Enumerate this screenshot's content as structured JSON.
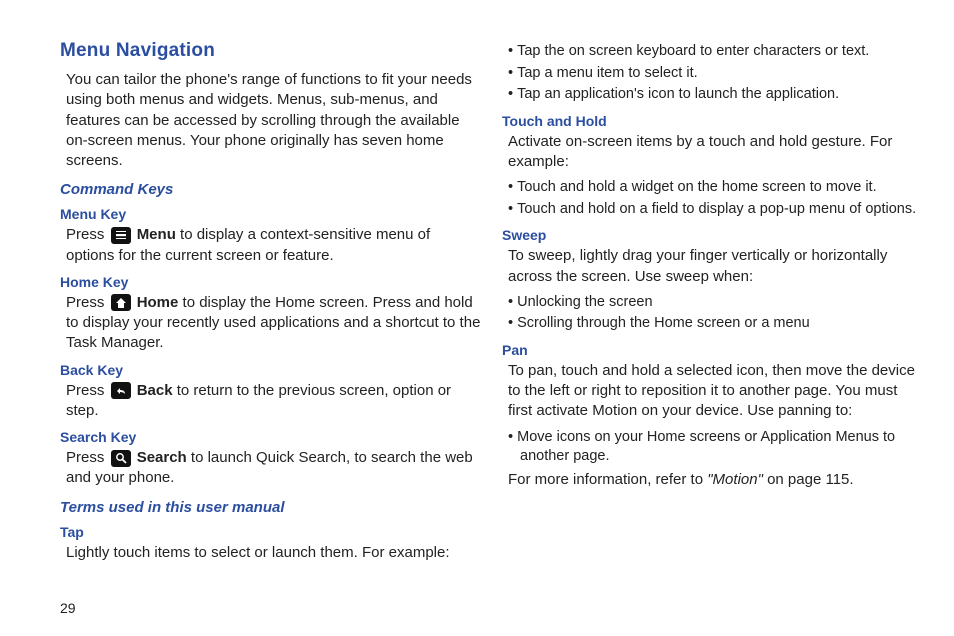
{
  "page_number": "29",
  "left": {
    "h1": "Menu Navigation",
    "intro": "You can tailor the phone's range of functions to fit your needs using both menus and widgets. Menus, sub-menus, and features can be accessed by scrolling through the available on-screen menus. Your phone originally has seven home screens.",
    "h2_command_keys": "Command Keys",
    "menu_key": {
      "h3": "Menu Key",
      "press": "Press ",
      "bold": "Menu",
      "rest": " to display a context-sensitive menu of options for the current screen or feature."
    },
    "home_key": {
      "h3": "Home Key",
      "press": "Press ",
      "bold": "Home",
      "rest": " to display the Home screen. Press and hold to display your recently used applications and a shortcut to the Task Manager."
    },
    "back_key": {
      "h3": "Back Key",
      "press": "Press ",
      "bold": "Back",
      "rest": " to return to the previous screen, option or step."
    },
    "search_key": {
      "h3": "Search Key",
      "press": "Press ",
      "bold": "Search",
      "rest": " to launch Quick Search, to search the web and your phone."
    },
    "h2_terms": "Terms used in this user manual",
    "tap": {
      "h3": "Tap",
      "body": "Lightly touch items to select or launch them. For example:"
    }
  },
  "right": {
    "tap_bullets": [
      "Tap the on screen keyboard to enter characters or text.",
      "Tap a menu item to select it.",
      "Tap an application's icon to launch the application."
    ],
    "touch_hold": {
      "h3": "Touch and Hold",
      "body": "Activate on-screen items by a touch and hold gesture. For example:",
      "bullets": [
        "Touch and hold a widget on the home screen to move it.",
        "Touch and hold on a field to display a pop-up menu of options."
      ]
    },
    "sweep": {
      "h3": "Sweep",
      "body": "To sweep, lightly drag your finger vertically or horizontally across the screen. Use sweep when:",
      "bullets": [
        "Unlocking the screen",
        "Scrolling through the Home screen or a menu"
      ]
    },
    "pan": {
      "h3": "Pan",
      "body": "To pan, touch and hold a selected icon, then move the device to the left or right to reposition it to another page. You must first activate Motion on your device. Use panning to:",
      "bullets": [
        "Move icons on your Home screens or Application Menus to another page."
      ],
      "more_pre": "For more information, refer to ",
      "more_ref": "\"Motion\"",
      "more_post": "  on page 115."
    }
  }
}
